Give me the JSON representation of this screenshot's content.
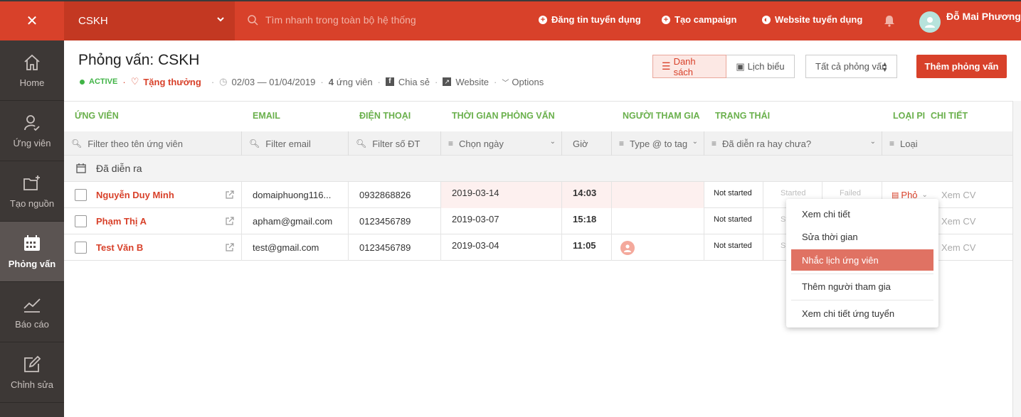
{
  "topbar": {
    "close_icon": "close-icon",
    "company": "CSKH",
    "search_placeholder": "Tìm nhanh trong toàn bộ hệ thống",
    "nav": [
      {
        "label": "Đăng tin tuyển dụng",
        "icon": "plus-circle-icon"
      },
      {
        "label": "Tạo campaign",
        "icon": "plus-circle-icon"
      },
      {
        "label": "Website tuyển dụng",
        "icon": "globe-icon"
      }
    ],
    "user_name": "Đỗ Mai Phương",
    "brand_color": "#d8412a"
  },
  "sidebar": {
    "items": [
      {
        "label": "Home",
        "icon": "home-icon"
      },
      {
        "label": "Ứng viên",
        "icon": "user-check-icon"
      },
      {
        "label": "Tạo nguồn",
        "icon": "folder-plus-icon"
      },
      {
        "label": "Phỏng vấn",
        "icon": "calendar-icon",
        "active": true
      },
      {
        "label": "Báo cáo",
        "icon": "chart-line-icon"
      },
      {
        "label": "Chỉnh sửa",
        "icon": "edit-icon"
      }
    ]
  },
  "header": {
    "title": "Phỏng vấn: CSKH",
    "status": "ACTIVE",
    "reward": "Tặng thưởng",
    "date_range": "02/03 — 01/04/2019",
    "candidate_count": "4",
    "candidate_label": "ứng viên",
    "share": "Chia sẻ",
    "website": "Website",
    "options": "Options",
    "view_list": "Danh sách",
    "view_calendar": "Lịch biểu",
    "filter_select": "Tất cả phỏng vấn",
    "add_button": "Thêm phỏng vấn"
  },
  "table": {
    "columns": [
      "ỨNG VIÊN",
      "EMAIL",
      "ĐIỆN THOẠI",
      "THỜI GIAN PHỎNG VẤN",
      "NGƯỜI THAM GIA",
      "TRẠNG THÁI",
      "LOẠI PI",
      "CHI TIẾT"
    ],
    "filters": {
      "name": "Filter theo tên ứng viên",
      "email": "Filter email",
      "phone": "Filter số ĐT",
      "date": "Chọn ngày",
      "time": "Giờ",
      "tag": "Type @ to tag",
      "status": "Đã diễn ra hay chưa?",
      "type": "Loại"
    },
    "group_label": "Đã diễn ra",
    "rows": [
      {
        "name": "Nguyễn Duy Minh",
        "email": "domaiphuong116...",
        "phone": "0932868826",
        "date": "2019-03-14",
        "time": "14:03",
        "status": "Not started",
        "started": "Started",
        "failed": "Failed",
        "type": "Phỏ",
        "detail": "Xem CV"
      },
      {
        "name": "Phạm Thị A",
        "email": "apham@gmail.com",
        "phone": "0123456789",
        "date": "2019-03-07",
        "time": "15:18",
        "status": "Not started",
        "started": "St",
        "detail": "Xem CV"
      },
      {
        "name": "Test Văn B",
        "email": "test@gmail.com",
        "phone": "0123456789",
        "date": "2019-03-04",
        "time": "11:05",
        "status": "Not started",
        "started": "St",
        "detail": "Xem CV"
      }
    ]
  },
  "dropdown": {
    "items": [
      "Xem chi tiết",
      "Sửa thời gian",
      "Nhắc lịch ứng viên",
      "Thêm người tham gia",
      "Xem chi tiết ứng tuyển"
    ],
    "highlighted": "Nhắc lịch ứng viên"
  }
}
